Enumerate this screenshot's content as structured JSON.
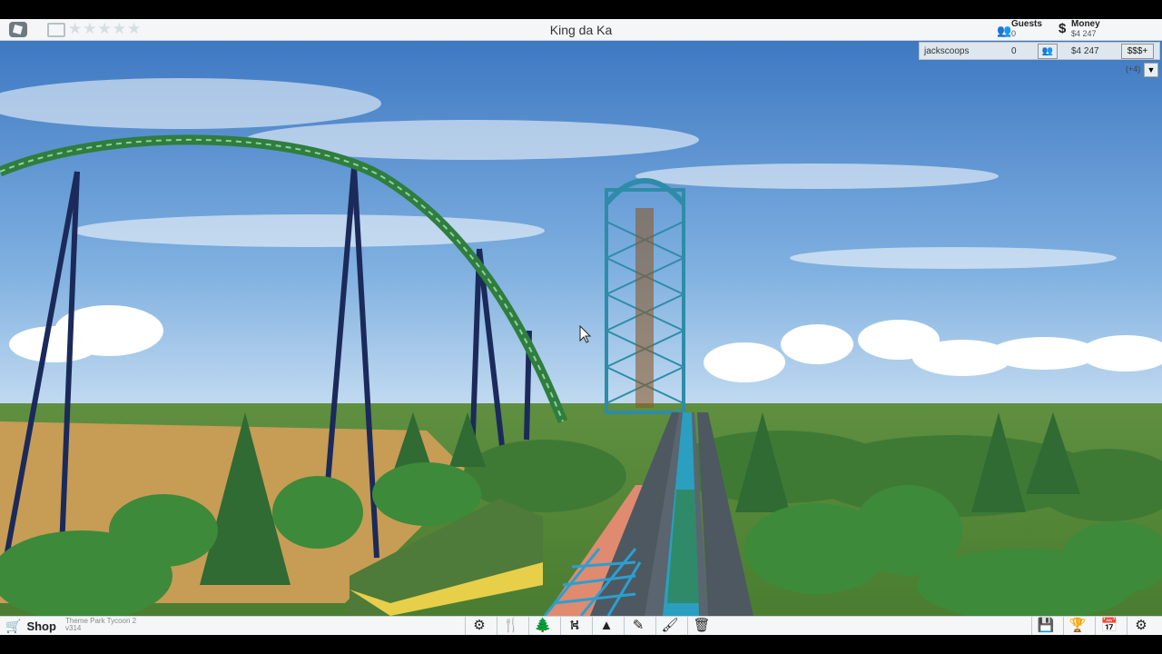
{
  "window": {
    "title": "King da Ka"
  },
  "rating": {
    "stars": 0,
    "max": 5
  },
  "stats": {
    "guests_label": "Guests",
    "guests_value": "0",
    "money_label": "Money",
    "money_value": "$4 247"
  },
  "players": [
    {
      "name": "jackscoops",
      "guests": "0",
      "money": "$4 247",
      "btn1": "👥",
      "btn2": "$$$+"
    }
  ],
  "players_more": "(+4)",
  "bottom": {
    "shop_label": "Shop",
    "game_name": "Theme Park Tycoon 2",
    "version": "v314"
  },
  "tools": [
    {
      "name": "rides-tool-icon",
      "glyph": "⚙"
    },
    {
      "name": "food-tool-icon",
      "glyph": "🍴"
    },
    {
      "name": "scenery-tool-icon",
      "glyph": "🌲"
    },
    {
      "name": "paths-tool-icon",
      "glyph": "⛕"
    },
    {
      "name": "terrain-tool-icon",
      "glyph": "▲"
    },
    {
      "name": "eyedropper-tool-icon",
      "glyph": "✎"
    },
    {
      "name": "paint-tool-icon",
      "glyph": "🖌"
    },
    {
      "name": "delete-tool-icon",
      "glyph": "🗑"
    }
  ],
  "tools_right": [
    {
      "name": "save-icon",
      "glyph": "💾"
    },
    {
      "name": "trophy-icon",
      "glyph": "🏆"
    },
    {
      "name": "calendar-icon",
      "glyph": "📅"
    },
    {
      "name": "settings-gear-icon",
      "glyph": "⚙"
    }
  ],
  "colors": {
    "track": "#2f7d3f",
    "supports": "#1b2a5a",
    "tower": "#2e8ca8",
    "sky": "#4a86c8",
    "grass": "#4f8c3a",
    "dirt": "#c79c55"
  }
}
